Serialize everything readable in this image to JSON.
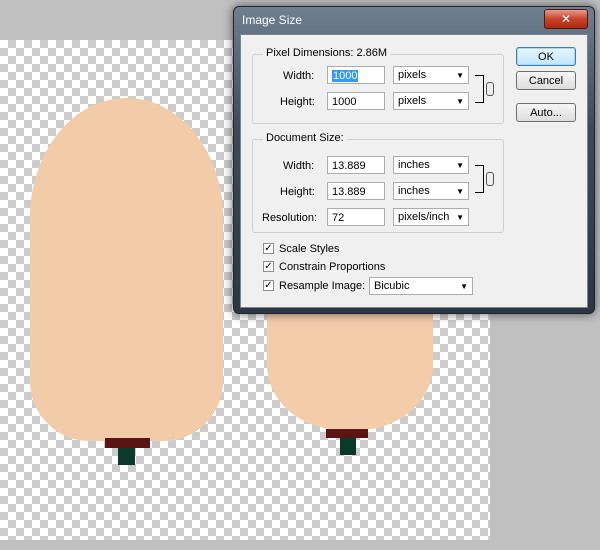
{
  "dialog": {
    "title": "Image Size",
    "close_label": "✕",
    "pixel_dimensions": {
      "label": "Pixel Dimensions:",
      "size": "2.86M",
      "width_label": "Width:",
      "width_value": "1000",
      "width_unit": "pixels",
      "height_label": "Height:",
      "height_value": "1000",
      "height_unit": "pixels"
    },
    "document_size": {
      "label": "Document Size:",
      "width_label": "Width:",
      "width_value": "13.889",
      "width_unit": "inches",
      "height_label": "Height:",
      "height_value": "13.889",
      "height_unit": "inches",
      "resolution_label": "Resolution:",
      "resolution_value": "72",
      "resolution_unit": "pixels/inch"
    },
    "options": {
      "scale_styles": "Scale Styles",
      "constrain_proportions": "Constrain Proportions",
      "resample_image": "Resample Image:",
      "resample_method": "Bicubic"
    },
    "buttons": {
      "ok": "OK",
      "cancel": "Cancel",
      "auto": "Auto..."
    }
  }
}
